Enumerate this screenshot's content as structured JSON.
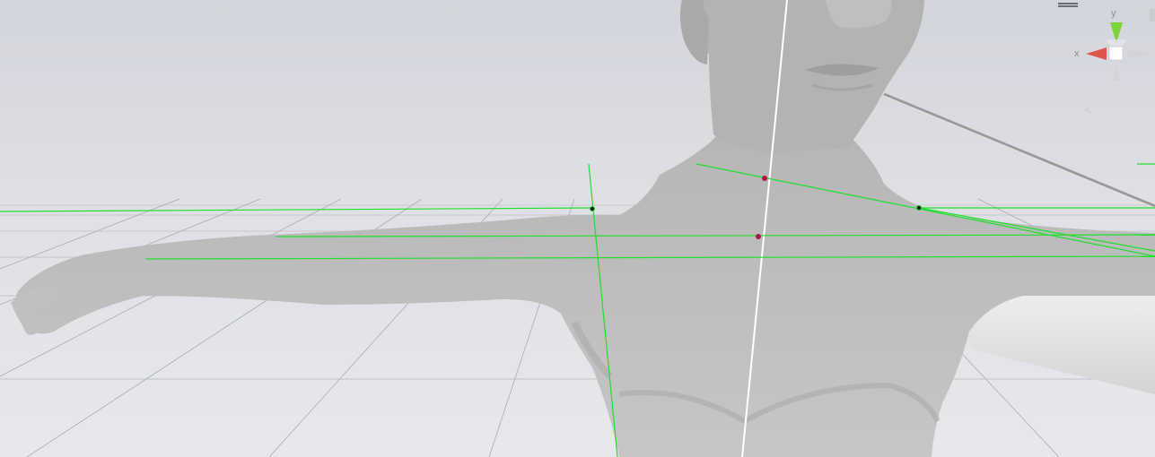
{
  "viewport": {
    "background_top": "#d5d7dd",
    "background_bottom": "#e6e7eb",
    "mesh_color": "#bdbdbd",
    "guide_color": "#22e12f",
    "axis_color": "#ffffff"
  },
  "scene_gizmo": {
    "y_label": "y",
    "x_label": "x",
    "y_color": "#7dd43a",
    "x_color": "#e0544b",
    "neutral_color": "#d3d4d8",
    "persp_icon": "perspective-arrow-icon"
  },
  "menu": {
    "icon": "hamburger-menu-icon"
  },
  "markers": {
    "joint_color": "#1a1a1a",
    "selected_color": "#b0174a"
  }
}
